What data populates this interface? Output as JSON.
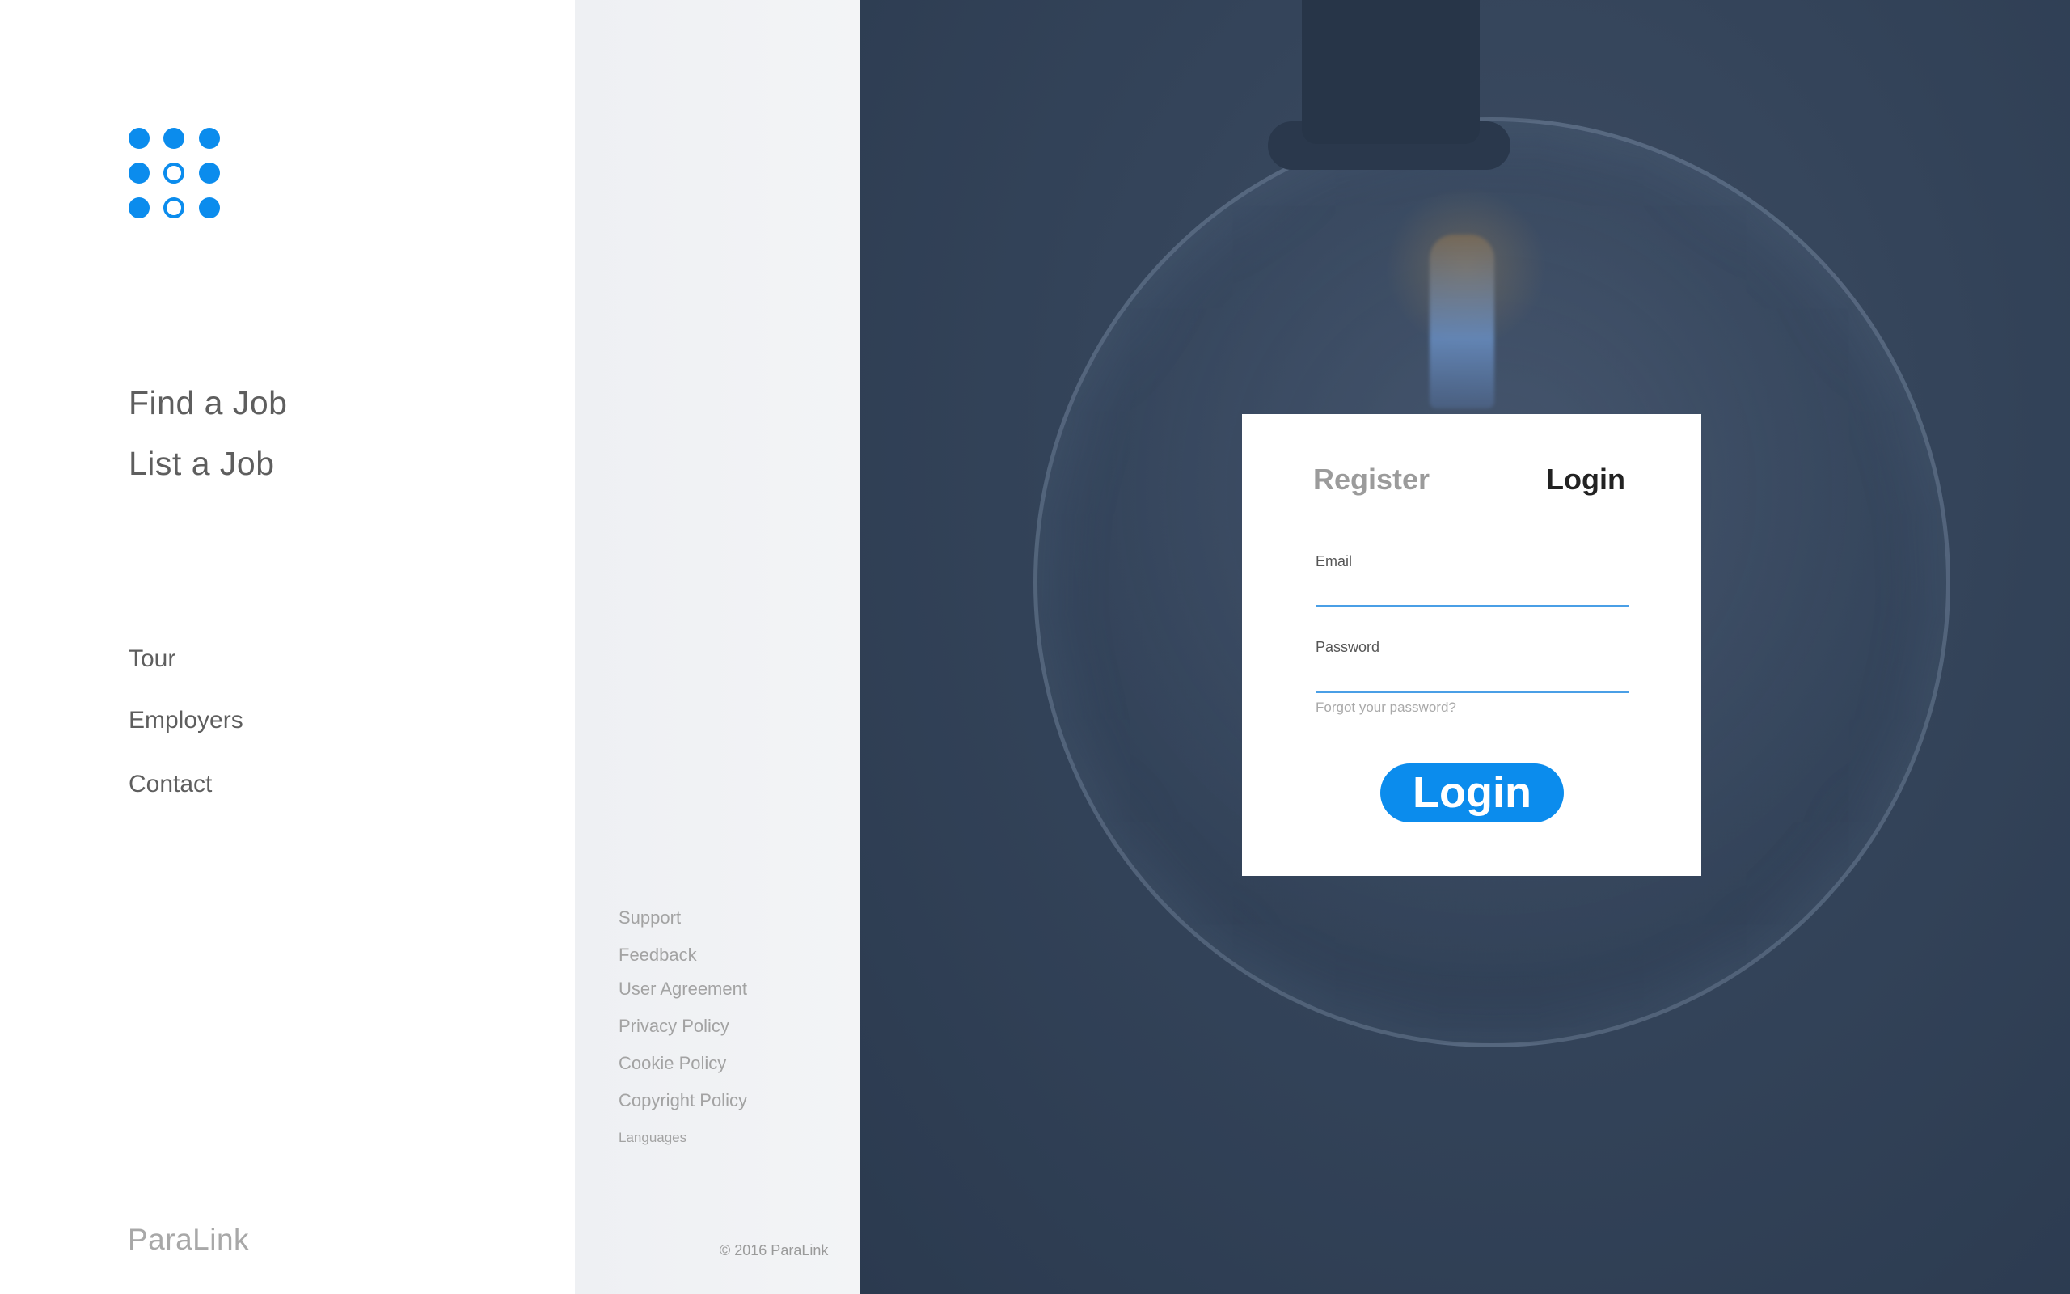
{
  "brand": {
    "name": "ParaLink"
  },
  "logo": {
    "icon": "dot-grid-logo-icon",
    "color": "#0b8ced"
  },
  "primary_nav": [
    {
      "label": "Find a Job"
    },
    {
      "label": "List a Job"
    }
  ],
  "secondary_nav": [
    {
      "label": "Tour"
    },
    {
      "label": "Employers"
    },
    {
      "label": "Contact"
    }
  ],
  "footer_links": [
    {
      "label": "Support"
    },
    {
      "label": "Feedback"
    },
    {
      "label": "User Agreement"
    },
    {
      "label": "Privacy Policy"
    },
    {
      "label": "Cookie Policy"
    },
    {
      "label": "Copyright Policy"
    },
    {
      "label": "Languages"
    }
  ],
  "copyright": "© 2016 ParaLink",
  "auth": {
    "tabs": {
      "register": "Register",
      "login": "Login"
    },
    "email": {
      "label": "Email",
      "value": "",
      "placeholder": ""
    },
    "password": {
      "label": "Password",
      "value": "",
      "placeholder": ""
    },
    "forgot_link": "Forgot your password?",
    "submit_label": "Login"
  },
  "colors": {
    "accent": "#0b8ced",
    "hero_overlay": "#34445a"
  }
}
